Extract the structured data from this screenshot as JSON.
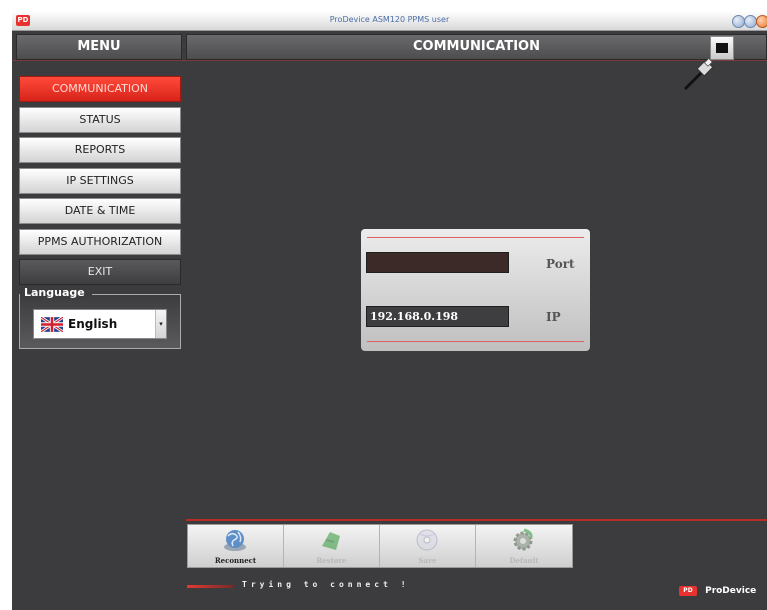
{
  "window": {
    "title": "ProDevice ASM120 PPMS user",
    "logo_text": "PD"
  },
  "menu": {
    "header": "MENU",
    "items": [
      {
        "label": "COMMUNICATION",
        "state": "active"
      },
      {
        "label": "STATUS",
        "state": "normal"
      },
      {
        "label": "REPORTS",
        "state": "normal"
      },
      {
        "label": "IP SETTINGS",
        "state": "normal"
      },
      {
        "label": "DATE & TIME",
        "state": "normal"
      },
      {
        "label": "PPMS AUTHORIZATION",
        "state": "normal"
      },
      {
        "label": "EXIT",
        "state": "dark"
      }
    ]
  },
  "language": {
    "legend": "Language",
    "selected": "English",
    "flag": "uk-flag-icon"
  },
  "main": {
    "header": "COMMUNICATION",
    "port": {
      "label": "Port",
      "value": ""
    },
    "ip": {
      "label": "IP",
      "value": "192.168.0.198"
    }
  },
  "toolbar": {
    "buttons": [
      {
        "label": "Reconnect",
        "icon": "globe-icon",
        "enabled": true
      },
      {
        "label": "Restore",
        "icon": "restore-icon",
        "enabled": false
      },
      {
        "label": "Save",
        "icon": "disc-icon",
        "enabled": false
      },
      {
        "label": "Default",
        "icon": "gear-icon",
        "enabled": false
      }
    ]
  },
  "status": {
    "text": "Trying to connect !"
  },
  "brand": {
    "logo_text": "PD",
    "name": "ProDevice"
  },
  "colors": {
    "accent_red": "#e8322f",
    "background": "#3c3c3e"
  }
}
